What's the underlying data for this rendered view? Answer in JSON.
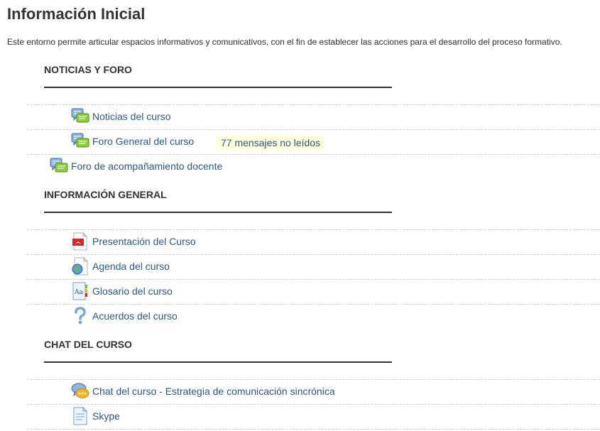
{
  "page": {
    "title": "Información Inicial",
    "summary": "Este entorno permite articular espacios informativos y comunicativos, con el fin de establecer las acciones para el desarrollo del proceso formativo."
  },
  "sections": {
    "noticias": {
      "header": "NOTICIAS Y FORO",
      "items": [
        {
          "label": "Noticias del curso",
          "icon": "forum-icon"
        },
        {
          "label": "Foro General del curso",
          "icon": "forum-icon",
          "unread": "77 mensajes no leídos"
        },
        {
          "label": "Foro de acompañamiento docente",
          "icon": "forum-icon"
        }
      ]
    },
    "informacion": {
      "header": "INFORMACIÓN GENERAL",
      "items": [
        {
          "label": "Presentación del Curso",
          "icon": "pdf-icon"
        },
        {
          "label": "Agenda del curso",
          "icon": "url-globe-icon"
        },
        {
          "label": "Glosario del curso",
          "icon": "glossary-icon"
        },
        {
          "label": "Acuerdos del curso",
          "icon": "question-icon"
        }
      ]
    },
    "chat": {
      "header": "CHAT DEL CURSO",
      "items": [
        {
          "label": "Chat del curso - Estrategia de comunicación sincrónica",
          "icon": "chat-icon"
        },
        {
          "label": "Skype",
          "icon": "page-icon"
        }
      ]
    }
  },
  "colors": {
    "link": "#2b5a8c",
    "text": "#333333",
    "unread_bg": "#ffffd8",
    "separator": "#cccccc"
  }
}
